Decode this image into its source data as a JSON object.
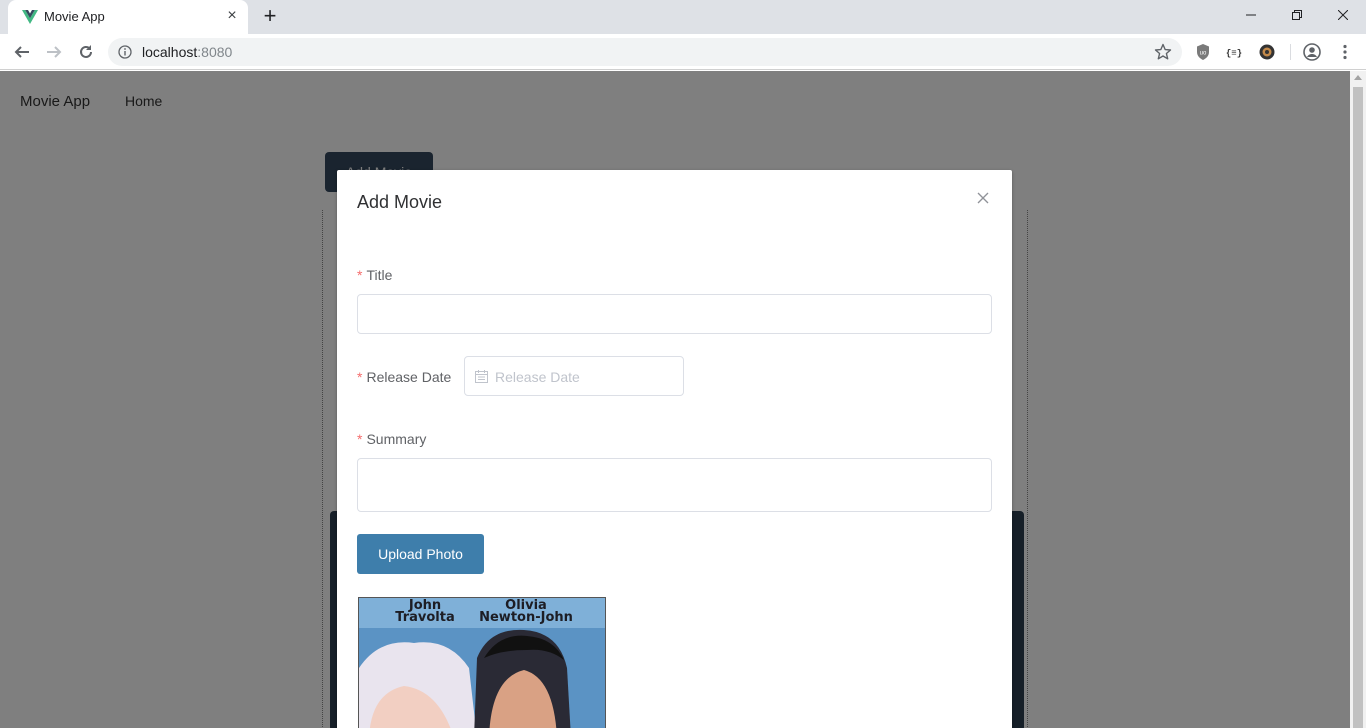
{
  "browser": {
    "tab_title": "Movie App",
    "url_host": "localhost",
    "url_port": ":8080"
  },
  "page": {
    "nav": {
      "brand": "Movie App",
      "home": "Home"
    },
    "add_movie_button": "Add Movie"
  },
  "modal": {
    "title": "Add Movie",
    "required_mark": "*",
    "fields": {
      "title": {
        "label": "Title",
        "value": ""
      },
      "release_date": {
        "label": "Release Date",
        "placeholder": "Release Date",
        "value": ""
      },
      "summary": {
        "label": "Summary",
        "value": ""
      }
    },
    "upload_button": "Upload Photo",
    "poster": {
      "actor_left_first": "John",
      "actor_left_last": "Travolta",
      "actor_right_first": "Olivia",
      "actor_right_last": "Newton-John"
    }
  },
  "colors": {
    "overlay": "rgba(0,0,0,0.5)",
    "upload_button": "#3e7eab",
    "add_movie_button": "#35495e",
    "required": "#f56c6c"
  },
  "icons": {
    "tab_favicon": "vue-logo-icon",
    "date_field": "calendar-icon",
    "modal_close": "close-icon"
  }
}
